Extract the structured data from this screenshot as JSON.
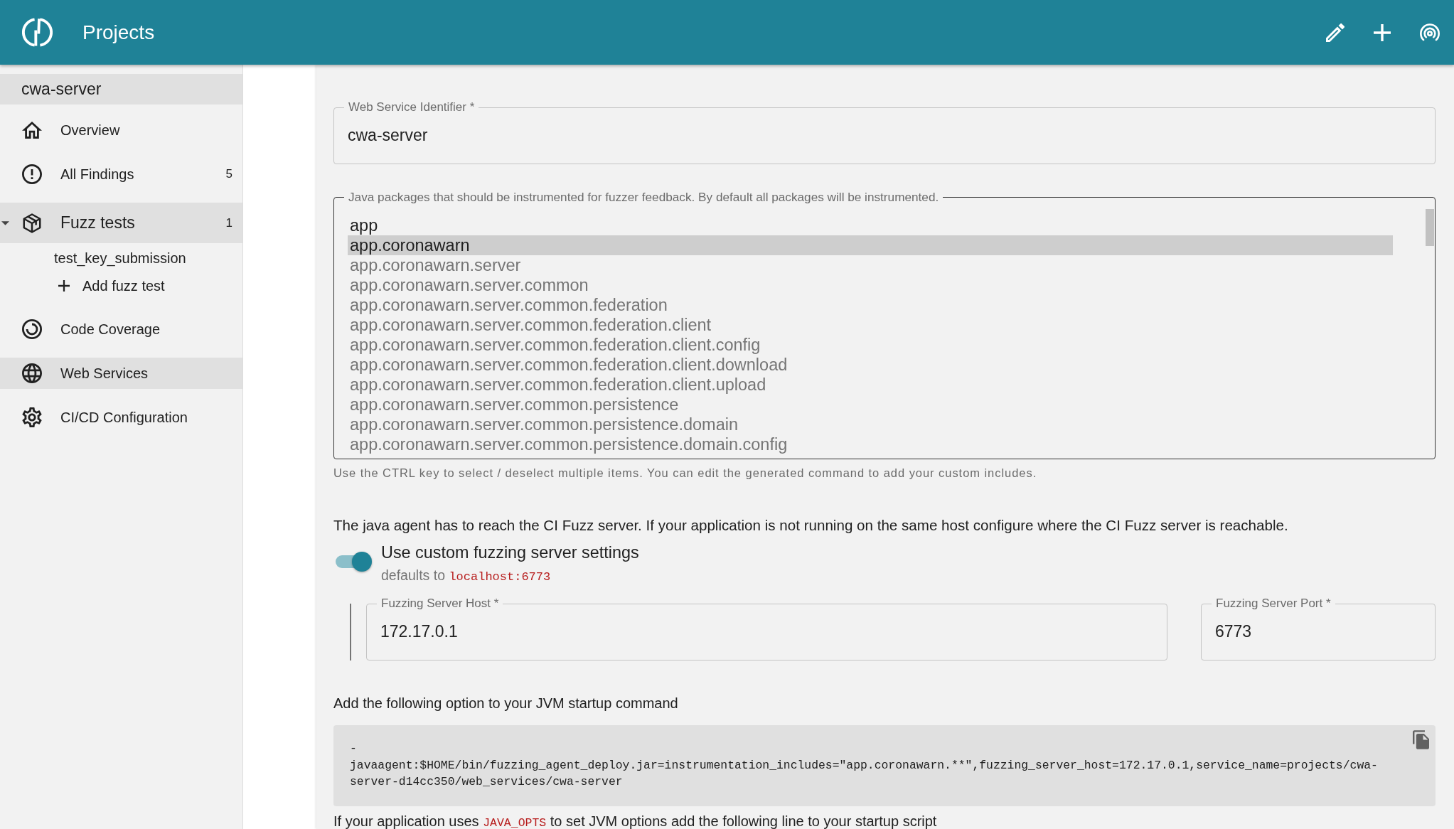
{
  "header": {
    "title": "Projects"
  },
  "sidebar": {
    "project": "cwa-server",
    "items": [
      {
        "label": "Overview",
        "selected": false
      },
      {
        "label": "All Findings",
        "count": "5",
        "selected": false
      },
      {
        "label": "Fuzz tests",
        "count": "1",
        "selected": true,
        "expanded": true,
        "children": [
          {
            "kind": "link",
            "label": "test_key_submission",
            "selected": false
          },
          {
            "kind": "action",
            "label": "Add fuzz test",
            "selected": false
          }
        ]
      },
      {
        "label": "Code Coverage",
        "selected": false
      },
      {
        "label": "Web Services",
        "selected": true
      },
      {
        "label": "CI/CD Configuration",
        "selected": false
      }
    ]
  },
  "web_service": {
    "label": "Web Service Identifier *",
    "value": "cwa-server"
  },
  "packages": {
    "label": "Java packages that should be instrumented for fuzzer feedback. By default all packages will be instrumented.",
    "options": [
      {
        "label": "app",
        "selected": false,
        "disabled": false
      },
      {
        "label": "app.coronawarn",
        "selected": true,
        "disabled": false
      },
      {
        "label": "app.coronawarn.server",
        "selected": false,
        "disabled": true
      },
      {
        "label": "app.coronawarn.server.common",
        "selected": false,
        "disabled": true
      },
      {
        "label": "app.coronawarn.server.common.federation",
        "selected": false,
        "disabled": true
      },
      {
        "label": "app.coronawarn.server.common.federation.client",
        "selected": false,
        "disabled": true
      },
      {
        "label": "app.coronawarn.server.common.federation.client.config",
        "selected": false,
        "disabled": true
      },
      {
        "label": "app.coronawarn.server.common.federation.client.download",
        "selected": false,
        "disabled": true
      },
      {
        "label": "app.coronawarn.server.common.federation.client.upload",
        "selected": false,
        "disabled": true
      },
      {
        "label": "app.coronawarn.server.common.persistence",
        "selected": false,
        "disabled": true
      },
      {
        "label": "app.coronawarn.server.common.persistence.domain",
        "selected": false,
        "disabled": true
      },
      {
        "label": "app.coronawarn.server.common.persistence.domain.config",
        "selected": false,
        "disabled": true
      }
    ],
    "help": "Use the CTRL key to select / deselect multiple items. You can edit the generated command to add your custom includes."
  },
  "server_settings": {
    "intro": "The java agent has to reach the CI Fuzz server. If your application is not running on the same host configure where the CI Fuzz server is reachable.",
    "toggle": {
      "label": "Use custom fuzzing server settings",
      "on": true,
      "hint": "defaults to",
      "hint_code": "localhost:6773"
    },
    "fields": [
      {
        "label": "Fuzzing Server Host *",
        "value": "172.17.0.1"
      },
      {
        "label": "Fuzzing Server Port *",
        "value": "6773"
      }
    ]
  },
  "command": {
    "label": "Add the following option to your JVM startup command",
    "code": "-javaagent:$HOME/bin/fuzzing_agent_deploy.jar=instrumentation_includes=\"app.coronawarn.**\",fuzzing_server_host=172.17.0.1,service_name=projects/cwa-server-d14cc350/web_services/cwa-server"
  },
  "java_opts_note": {
    "before": "If your application uses",
    "code": "JAVA_OPTS",
    "after": "to set JVM options add the following line to your startup script"
  }
}
